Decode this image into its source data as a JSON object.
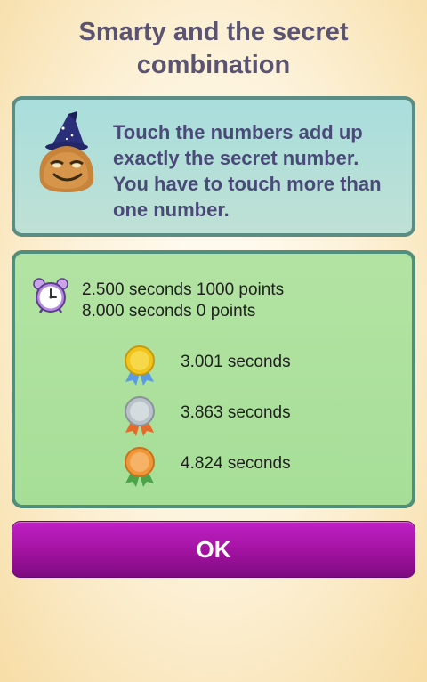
{
  "title": "Smarty and the secret\ncombination",
  "info": {
    "mascot_icon": "wizard-pou-icon",
    "text": "Touch the numbers add up exactly the secret number. You have to touch more than one number."
  },
  "scoring": {
    "clock_icon": "alarm-clock-icon",
    "lines": [
      "2.500 seconds 1000 points",
      "8.000 seconds 0 points"
    ],
    "medals": [
      {
        "icon": "gold-medal-icon",
        "label": "3.001 seconds",
        "color": "#f0c419"
      },
      {
        "icon": "silver-medal-icon",
        "label": "3.863 seconds",
        "color": "#b9c2c8"
      },
      {
        "icon": "bronze-medal-icon",
        "label": "4.824 seconds",
        "color": "#f0973a"
      }
    ]
  },
  "ok_button": {
    "label": "OK"
  },
  "colors": {
    "title": "#5a5371",
    "info_panel_bg": "#a9dedd",
    "score_panel_bg": "#b3e3a3",
    "button_bg": "#a1129f"
  }
}
